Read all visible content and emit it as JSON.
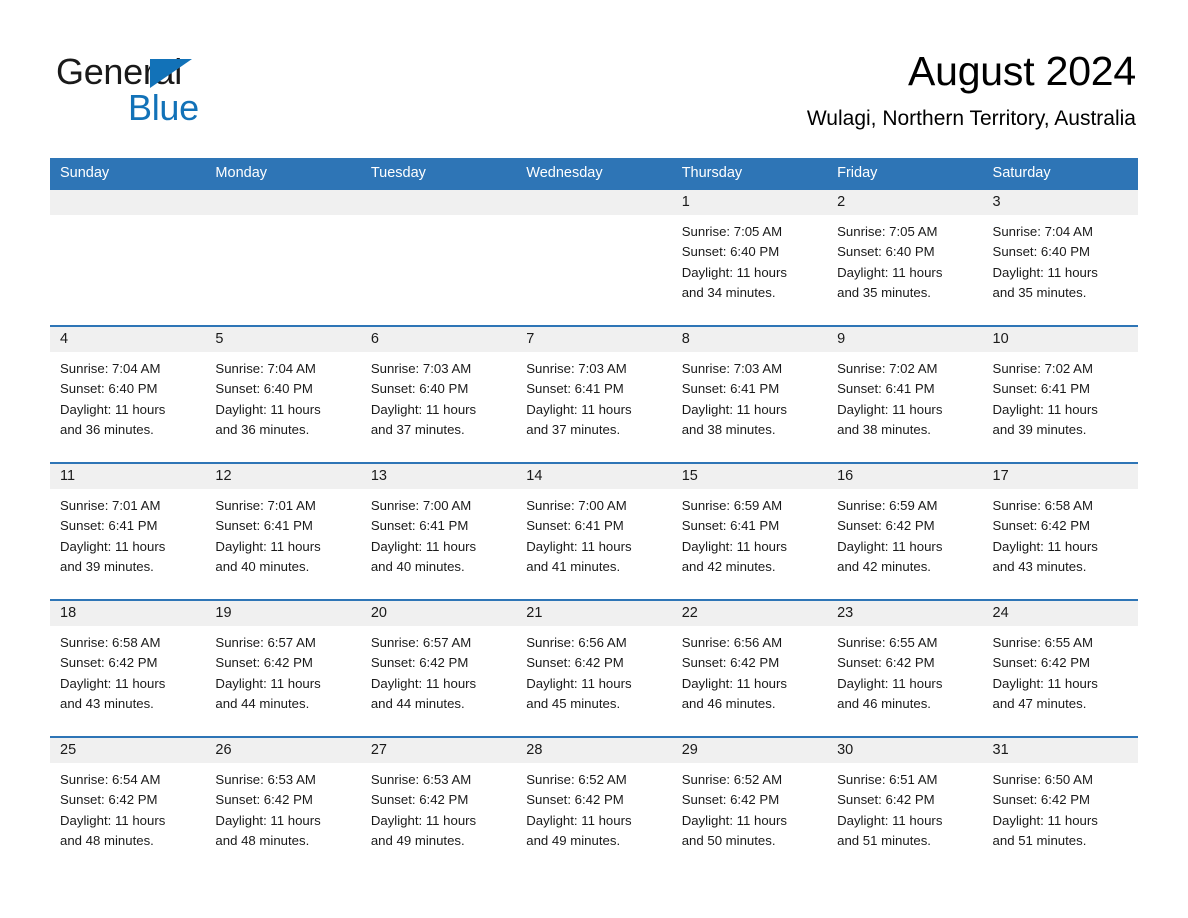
{
  "brand": {
    "name_part1": "General",
    "name_part2": "Blue",
    "triangle_color": "#1272b8",
    "text_color": "#1a1a1a"
  },
  "header": {
    "month_title": "August 2024",
    "location": "Wulagi, Northern Territory, Australia"
  },
  "colors": {
    "header_blue": "#2e75b6",
    "date_band_gray": "#f0f0f0",
    "row_divider_blue": "#2e75b6",
    "text": "#1a1a1a"
  },
  "weekdays": [
    "Sunday",
    "Monday",
    "Tuesday",
    "Wednesday",
    "Thursday",
    "Friday",
    "Saturday"
  ],
  "labels": {
    "sunrise_prefix": "Sunrise:",
    "sunset_prefix": "Sunset:",
    "daylight_prefix": "Daylight:"
  },
  "weeks": [
    {
      "days": [
        {
          "date": "",
          "sunrise": "",
          "sunset": "",
          "daylight_line1": "",
          "daylight_line2": ""
        },
        {
          "date": "",
          "sunrise": "",
          "sunset": "",
          "daylight_line1": "",
          "daylight_line2": ""
        },
        {
          "date": "",
          "sunrise": "",
          "sunset": "",
          "daylight_line1": "",
          "daylight_line2": ""
        },
        {
          "date": "",
          "sunrise": "",
          "sunset": "",
          "daylight_line1": "",
          "daylight_line2": ""
        },
        {
          "date": "1",
          "sunrise": "Sunrise: 7:05 AM",
          "sunset": "Sunset: 6:40 PM",
          "daylight_line1": "Daylight: 11 hours",
          "daylight_line2": "and 34 minutes."
        },
        {
          "date": "2",
          "sunrise": "Sunrise: 7:05 AM",
          "sunset": "Sunset: 6:40 PM",
          "daylight_line1": "Daylight: 11 hours",
          "daylight_line2": "and 35 minutes."
        },
        {
          "date": "3",
          "sunrise": "Sunrise: 7:04 AM",
          "sunset": "Sunset: 6:40 PM",
          "daylight_line1": "Daylight: 11 hours",
          "daylight_line2": "and 35 minutes."
        }
      ]
    },
    {
      "days": [
        {
          "date": "4",
          "sunrise": "Sunrise: 7:04 AM",
          "sunset": "Sunset: 6:40 PM",
          "daylight_line1": "Daylight: 11 hours",
          "daylight_line2": "and 36 minutes."
        },
        {
          "date": "5",
          "sunrise": "Sunrise: 7:04 AM",
          "sunset": "Sunset: 6:40 PM",
          "daylight_line1": "Daylight: 11 hours",
          "daylight_line2": "and 36 minutes."
        },
        {
          "date": "6",
          "sunrise": "Sunrise: 7:03 AM",
          "sunset": "Sunset: 6:40 PM",
          "daylight_line1": "Daylight: 11 hours",
          "daylight_line2": "and 37 minutes."
        },
        {
          "date": "7",
          "sunrise": "Sunrise: 7:03 AM",
          "sunset": "Sunset: 6:41 PM",
          "daylight_line1": "Daylight: 11 hours",
          "daylight_line2": "and 37 minutes."
        },
        {
          "date": "8",
          "sunrise": "Sunrise: 7:03 AM",
          "sunset": "Sunset: 6:41 PM",
          "daylight_line1": "Daylight: 11 hours",
          "daylight_line2": "and 38 minutes."
        },
        {
          "date": "9",
          "sunrise": "Sunrise: 7:02 AM",
          "sunset": "Sunset: 6:41 PM",
          "daylight_line1": "Daylight: 11 hours",
          "daylight_line2": "and 38 minutes."
        },
        {
          "date": "10",
          "sunrise": "Sunrise: 7:02 AM",
          "sunset": "Sunset: 6:41 PM",
          "daylight_line1": "Daylight: 11 hours",
          "daylight_line2": "and 39 minutes."
        }
      ]
    },
    {
      "days": [
        {
          "date": "11",
          "sunrise": "Sunrise: 7:01 AM",
          "sunset": "Sunset: 6:41 PM",
          "daylight_line1": "Daylight: 11 hours",
          "daylight_line2": "and 39 minutes."
        },
        {
          "date": "12",
          "sunrise": "Sunrise: 7:01 AM",
          "sunset": "Sunset: 6:41 PM",
          "daylight_line1": "Daylight: 11 hours",
          "daylight_line2": "and 40 minutes."
        },
        {
          "date": "13",
          "sunrise": "Sunrise: 7:00 AM",
          "sunset": "Sunset: 6:41 PM",
          "daylight_line1": "Daylight: 11 hours",
          "daylight_line2": "and 40 minutes."
        },
        {
          "date": "14",
          "sunrise": "Sunrise: 7:00 AM",
          "sunset": "Sunset: 6:41 PM",
          "daylight_line1": "Daylight: 11 hours",
          "daylight_line2": "and 41 minutes."
        },
        {
          "date": "15",
          "sunrise": "Sunrise: 6:59 AM",
          "sunset": "Sunset: 6:41 PM",
          "daylight_line1": "Daylight: 11 hours",
          "daylight_line2": "and 42 minutes."
        },
        {
          "date": "16",
          "sunrise": "Sunrise: 6:59 AM",
          "sunset": "Sunset: 6:42 PM",
          "daylight_line1": "Daylight: 11 hours",
          "daylight_line2": "and 42 minutes."
        },
        {
          "date": "17",
          "sunrise": "Sunrise: 6:58 AM",
          "sunset": "Sunset: 6:42 PM",
          "daylight_line1": "Daylight: 11 hours",
          "daylight_line2": "and 43 minutes."
        }
      ]
    },
    {
      "days": [
        {
          "date": "18",
          "sunrise": "Sunrise: 6:58 AM",
          "sunset": "Sunset: 6:42 PM",
          "daylight_line1": "Daylight: 11 hours",
          "daylight_line2": "and 43 minutes."
        },
        {
          "date": "19",
          "sunrise": "Sunrise: 6:57 AM",
          "sunset": "Sunset: 6:42 PM",
          "daylight_line1": "Daylight: 11 hours",
          "daylight_line2": "and 44 minutes."
        },
        {
          "date": "20",
          "sunrise": "Sunrise: 6:57 AM",
          "sunset": "Sunset: 6:42 PM",
          "daylight_line1": "Daylight: 11 hours",
          "daylight_line2": "and 44 minutes."
        },
        {
          "date": "21",
          "sunrise": "Sunrise: 6:56 AM",
          "sunset": "Sunset: 6:42 PM",
          "daylight_line1": "Daylight: 11 hours",
          "daylight_line2": "and 45 minutes."
        },
        {
          "date": "22",
          "sunrise": "Sunrise: 6:56 AM",
          "sunset": "Sunset: 6:42 PM",
          "daylight_line1": "Daylight: 11 hours",
          "daylight_line2": "and 46 minutes."
        },
        {
          "date": "23",
          "sunrise": "Sunrise: 6:55 AM",
          "sunset": "Sunset: 6:42 PM",
          "daylight_line1": "Daylight: 11 hours",
          "daylight_line2": "and 46 minutes."
        },
        {
          "date": "24",
          "sunrise": "Sunrise: 6:55 AM",
          "sunset": "Sunset: 6:42 PM",
          "daylight_line1": "Daylight: 11 hours",
          "daylight_line2": "and 47 minutes."
        }
      ]
    },
    {
      "days": [
        {
          "date": "25",
          "sunrise": "Sunrise: 6:54 AM",
          "sunset": "Sunset: 6:42 PM",
          "daylight_line1": "Daylight: 11 hours",
          "daylight_line2": "and 48 minutes."
        },
        {
          "date": "26",
          "sunrise": "Sunrise: 6:53 AM",
          "sunset": "Sunset: 6:42 PM",
          "daylight_line1": "Daylight: 11 hours",
          "daylight_line2": "and 48 minutes."
        },
        {
          "date": "27",
          "sunrise": "Sunrise: 6:53 AM",
          "sunset": "Sunset: 6:42 PM",
          "daylight_line1": "Daylight: 11 hours",
          "daylight_line2": "and 49 minutes."
        },
        {
          "date": "28",
          "sunrise": "Sunrise: 6:52 AM",
          "sunset": "Sunset: 6:42 PM",
          "daylight_line1": "Daylight: 11 hours",
          "daylight_line2": "and 49 minutes."
        },
        {
          "date": "29",
          "sunrise": "Sunrise: 6:52 AM",
          "sunset": "Sunset: 6:42 PM",
          "daylight_line1": "Daylight: 11 hours",
          "daylight_line2": "and 50 minutes."
        },
        {
          "date": "30",
          "sunrise": "Sunrise: 6:51 AM",
          "sunset": "Sunset: 6:42 PM",
          "daylight_line1": "Daylight: 11 hours",
          "daylight_line2": "and 51 minutes."
        },
        {
          "date": "31",
          "sunrise": "Sunrise: 6:50 AM",
          "sunset": "Sunset: 6:42 PM",
          "daylight_line1": "Daylight: 11 hours",
          "daylight_line2": "and 51 minutes."
        }
      ]
    }
  ]
}
